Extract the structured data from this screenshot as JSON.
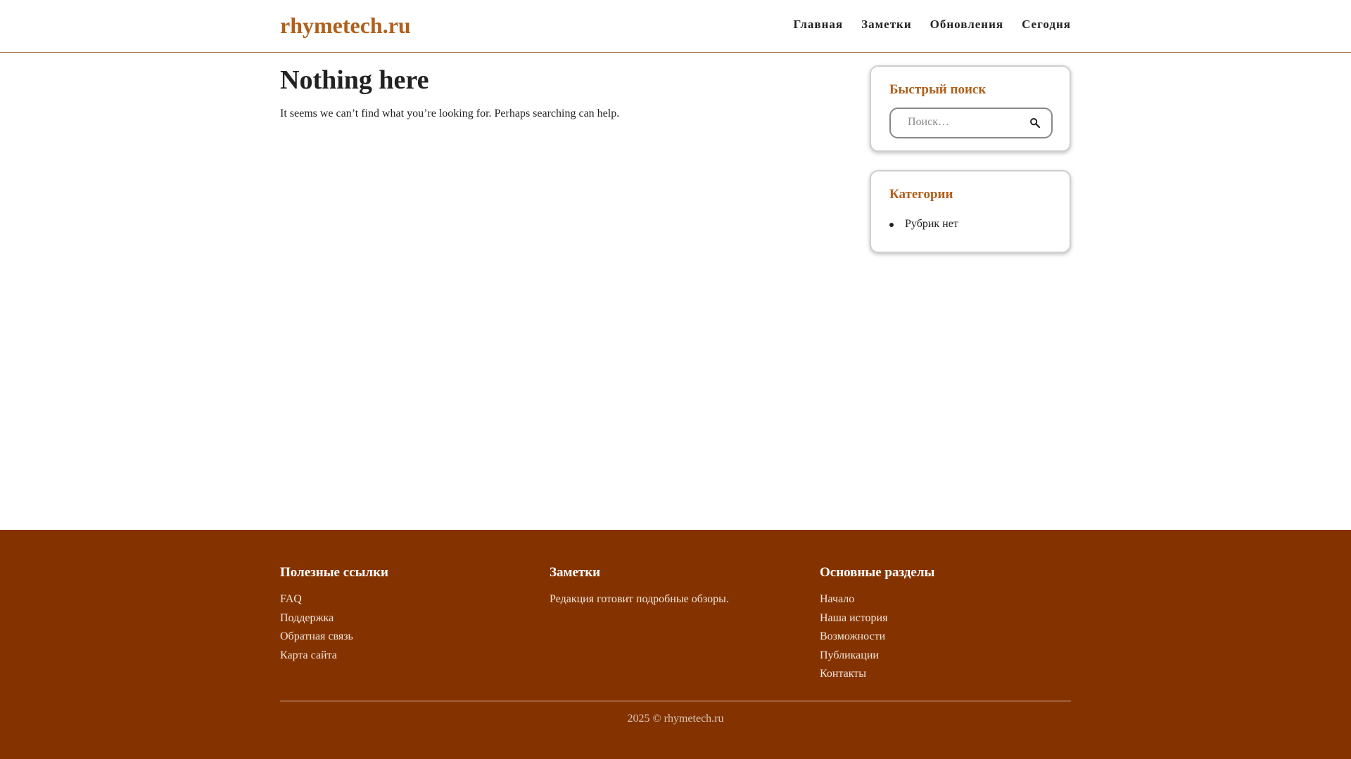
{
  "site": {
    "logo": "rhymetech.ru",
    "nav": [
      "Главная",
      "Заметки",
      "Обновления",
      "Сегодня"
    ]
  },
  "main": {
    "title": "Nothing here",
    "text": "It seems we can’t find what you’re looking for. Perhaps searching can help."
  },
  "sidebar": {
    "search": {
      "title": "Быстрый поиск",
      "placeholder": "Поиск…",
      "icon": "search-icon"
    },
    "categories": {
      "title": "Категории",
      "items": [
        "Рубрик нет"
      ]
    }
  },
  "footer": {
    "col1": {
      "title": "Полезные ссылки",
      "links": [
        "FAQ",
        "Поддержка",
        "Обратная связь",
        "Карта сайта"
      ]
    },
    "col2": {
      "title": "Заметки",
      "text": "Редакция готовит подробные обзоры."
    },
    "col3": {
      "title": "Основные разделы",
      "links": [
        "Начало",
        "Наша история",
        "Возможности",
        "Публикации",
        "Контакты"
      ]
    },
    "copyright": "2025 © rhymetech.ru"
  },
  "colors": {
    "accent": "#b0601b",
    "footer_bg": "#843300"
  }
}
